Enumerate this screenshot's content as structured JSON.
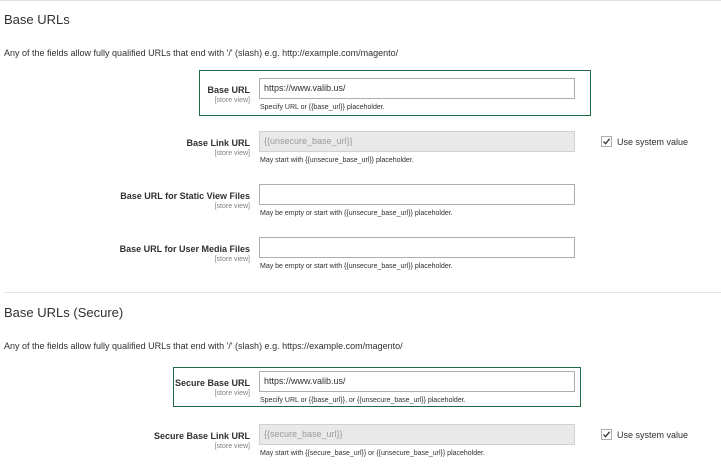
{
  "sections": [
    {
      "title": "Base URLs",
      "note": "Any of the fields allow fully qualified URLs that end with '/' (slash) e.g. http://example.com/magento/",
      "fields": [
        {
          "label": "Base URL",
          "scope": "[store view]",
          "value": "https://www.valib.us/",
          "placeholder": "",
          "note": "Specify URL or {{base_url}} placeholder."
        },
        {
          "label": "Base Link URL",
          "scope": "[store view]",
          "value": "",
          "placeholder": "{{unsecure_base_url}}",
          "note": "May start with {{unsecure_base_url}} placeholder.",
          "use_system_value": "Use system value"
        },
        {
          "label": "Base URL for Static View Files",
          "scope": "[store view]",
          "value": "",
          "placeholder": "",
          "note": "May be empty or start with {{unsecure_base_url}} placeholder."
        },
        {
          "label": "Base URL for User Media Files",
          "scope": "[store view]",
          "value": "",
          "placeholder": "",
          "note": "May be empty or start with {{unsecure_base_url}} placeholder."
        }
      ]
    },
    {
      "title": "Base URLs (Secure)",
      "note": "Any of the fields allow fully qualified URLs that end with '/' (slash) e.g. https://example.com/magento/",
      "fields": [
        {
          "label": "Secure Base URL",
          "scope": "[store view]",
          "value": "https://www.valib.us/",
          "placeholder": "",
          "note": "Specify URL or {{base_url}}, or {{unsecure_base_url}} placeholder."
        },
        {
          "label": "Secure Base Link URL",
          "scope": "[store view]",
          "value": "",
          "placeholder": "{{secure_base_url}}",
          "note": "May start with {{secure_base_url}} or {{unsecure_base_url}} placeholder.",
          "use_system_value": "Use system value"
        }
      ]
    }
  ],
  "colors": {
    "highlight": "#1f6b43",
    "input_border": "#adadad",
    "disabled_bg": "#e9e9e9"
  },
  "icons": {
    "checkbox_checked": "check-icon"
  }
}
